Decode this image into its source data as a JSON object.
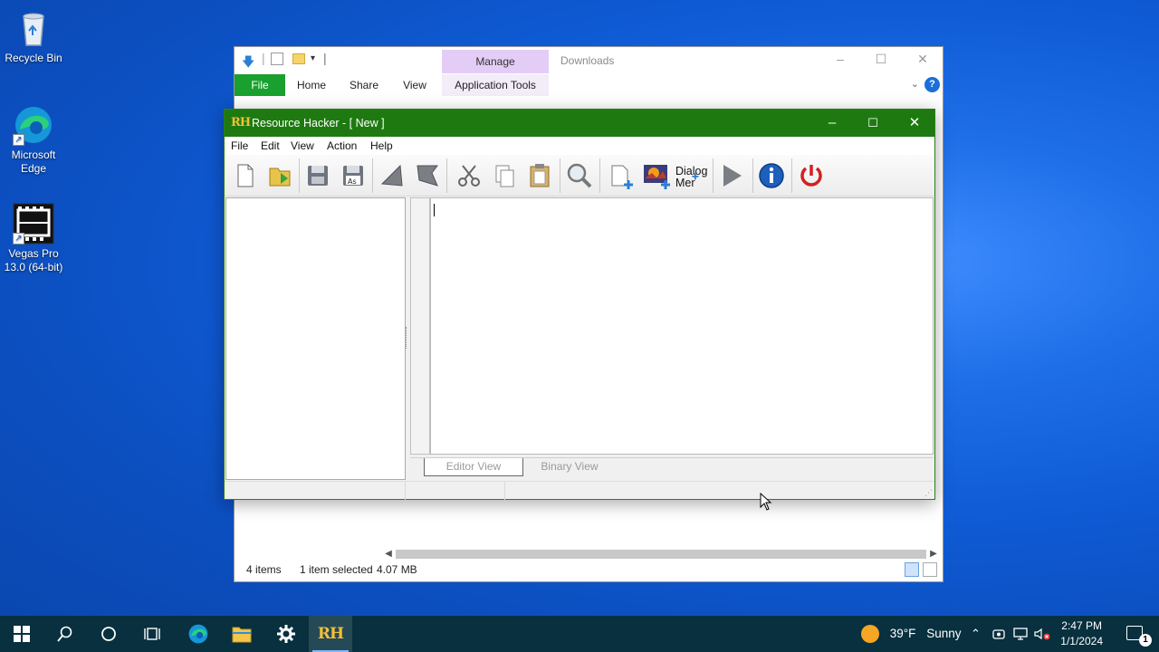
{
  "desktop": {
    "icons": [
      {
        "label": "Recycle Bin",
        "icon": "recycle-bin-icon"
      },
      {
        "label": "Microsoft\nEdge",
        "icon": "edge-icon"
      },
      {
        "label": "Vegas Pro\n13.0 (64-bit)",
        "icon": "vegas-icon"
      }
    ]
  },
  "explorer": {
    "title": "Downloads",
    "context_tab": "Manage",
    "tabs": [
      "File",
      "Home",
      "Share",
      "View",
      "Application Tools"
    ],
    "status": {
      "items": "4 items",
      "selected": "1 item selected",
      "size": "4.07 MB"
    }
  },
  "resource_hacker": {
    "logo": "RH",
    "title": "Resource Hacker - [ New ]",
    "menu": [
      "File",
      "Edit",
      "View",
      "Action",
      "Help"
    ],
    "toolbar": {
      "dialog_label_1": "Dialog",
      "dialog_label_2": "Mer"
    },
    "view_tabs": {
      "editor": "Editor View",
      "binary": "Binary View"
    }
  },
  "taskbar": {
    "weather": {
      "temp": "39°F",
      "condition": "Sunny"
    },
    "time": "2:47 PM",
    "date": "1/1/2024",
    "notifications": "1",
    "app_label": "RH"
  },
  "colors": {
    "rh_title_bg": "#1e7a10",
    "explorer_file_tab": "#19a02e",
    "manage_tab": "#e3cdf6",
    "taskbar_bg": "#08303f"
  }
}
